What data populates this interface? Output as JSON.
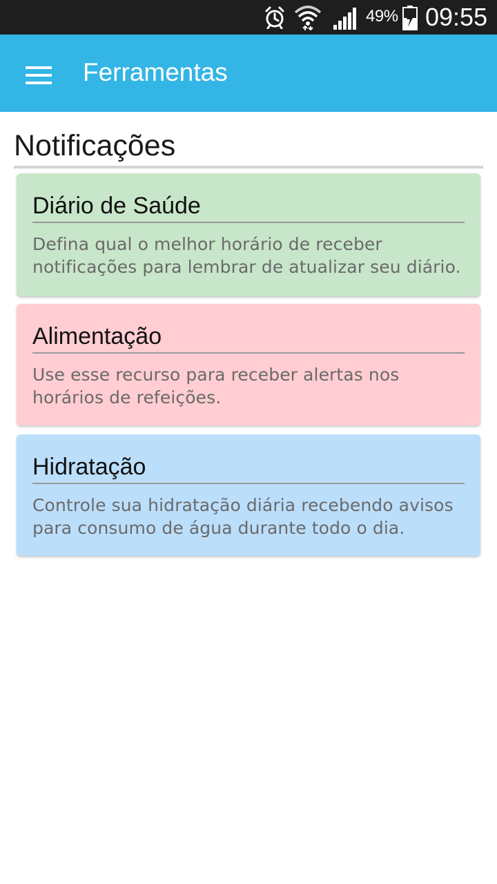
{
  "status_bar": {
    "icons": [
      "alarm-icon",
      "wifi-icon",
      "signal-icon",
      "battery-charging-icon"
    ],
    "battery_percent": "49%",
    "time": "09:55"
  },
  "app_bar": {
    "menu_icon": "hamburger-menu-icon",
    "title": "Ferramentas",
    "color": "#33b5e5"
  },
  "section": {
    "title": "Notificações"
  },
  "cards": [
    {
      "title": "Diário de Saúde",
      "description": "Defina qual o melhor horário de receber notificações para lembrar de atualizar seu diário.",
      "color": "#c8e6c9"
    },
    {
      "title": "Alimentação",
      "description": "Use esse recurso para receber alertas nos horários de refeições.",
      "color": "#ffcdd2"
    },
    {
      "title": "Hidratação",
      "description": "Controle sua hidratação diária recebendo avisos para consumo de água durante todo o dia.",
      "color": "#bbdefb"
    }
  ]
}
